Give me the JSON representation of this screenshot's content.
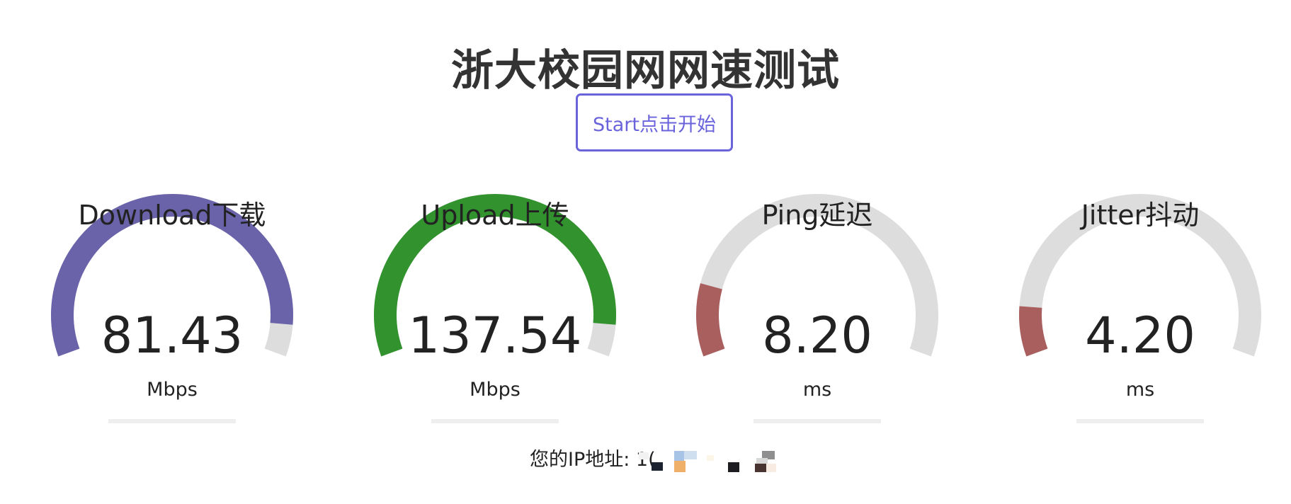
{
  "header": {
    "title": "浙大校园网网速测试"
  },
  "start_button": {
    "label": "Start点击开始"
  },
  "meters": [
    {
      "id": "download",
      "label": "Download下载",
      "value": "81.43",
      "unit": "Mbps",
      "fill_fraction": 0.93,
      "fill_color": "#6a63aa"
    },
    {
      "id": "upload",
      "label": "Upload上传",
      "value": "137.54",
      "unit": "Mbps",
      "fill_fraction": 0.93,
      "fill_color": "#31922e"
    },
    {
      "id": "ping",
      "label": "Ping延迟",
      "value": "8.20",
      "unit": "ms",
      "fill_fraction": 0.16,
      "fill_color": "#aa5f5f"
    },
    {
      "id": "jitter",
      "label": "Jitter抖动",
      "value": "4.20",
      "unit": "ms",
      "fill_fraction": 0.11,
      "fill_color": "#aa5f5f"
    }
  ],
  "gauge_track_color": "#dddddd",
  "ip": {
    "label": "您的IP地址: 1(",
    "value_obscured": true
  }
}
